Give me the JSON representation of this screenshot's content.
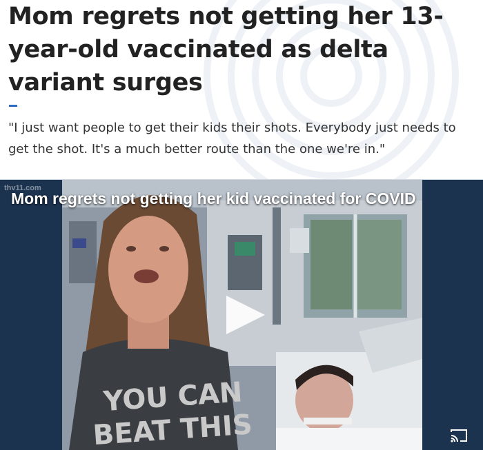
{
  "article": {
    "headline": "Mom regrets not getting her 13-year-old vaccinated as delta variant surges",
    "deck": "\"I just want people to get their kids their shots. Everybody just needs to get the shot. It's a much better route than the one we're in.\""
  },
  "video": {
    "title": "Mom regrets not getting her kid vaccinated for COVID",
    "watermark": "thv11.com",
    "shirt_text_line1": "YOU CAN",
    "shirt_text_line2": "BEAT THIS",
    "play_icon": "play-icon",
    "cast_icon": "cast-icon"
  },
  "colors": {
    "headline": "#222222",
    "accent": "#2b6cc4",
    "video_bg": "#1a2f4a"
  }
}
